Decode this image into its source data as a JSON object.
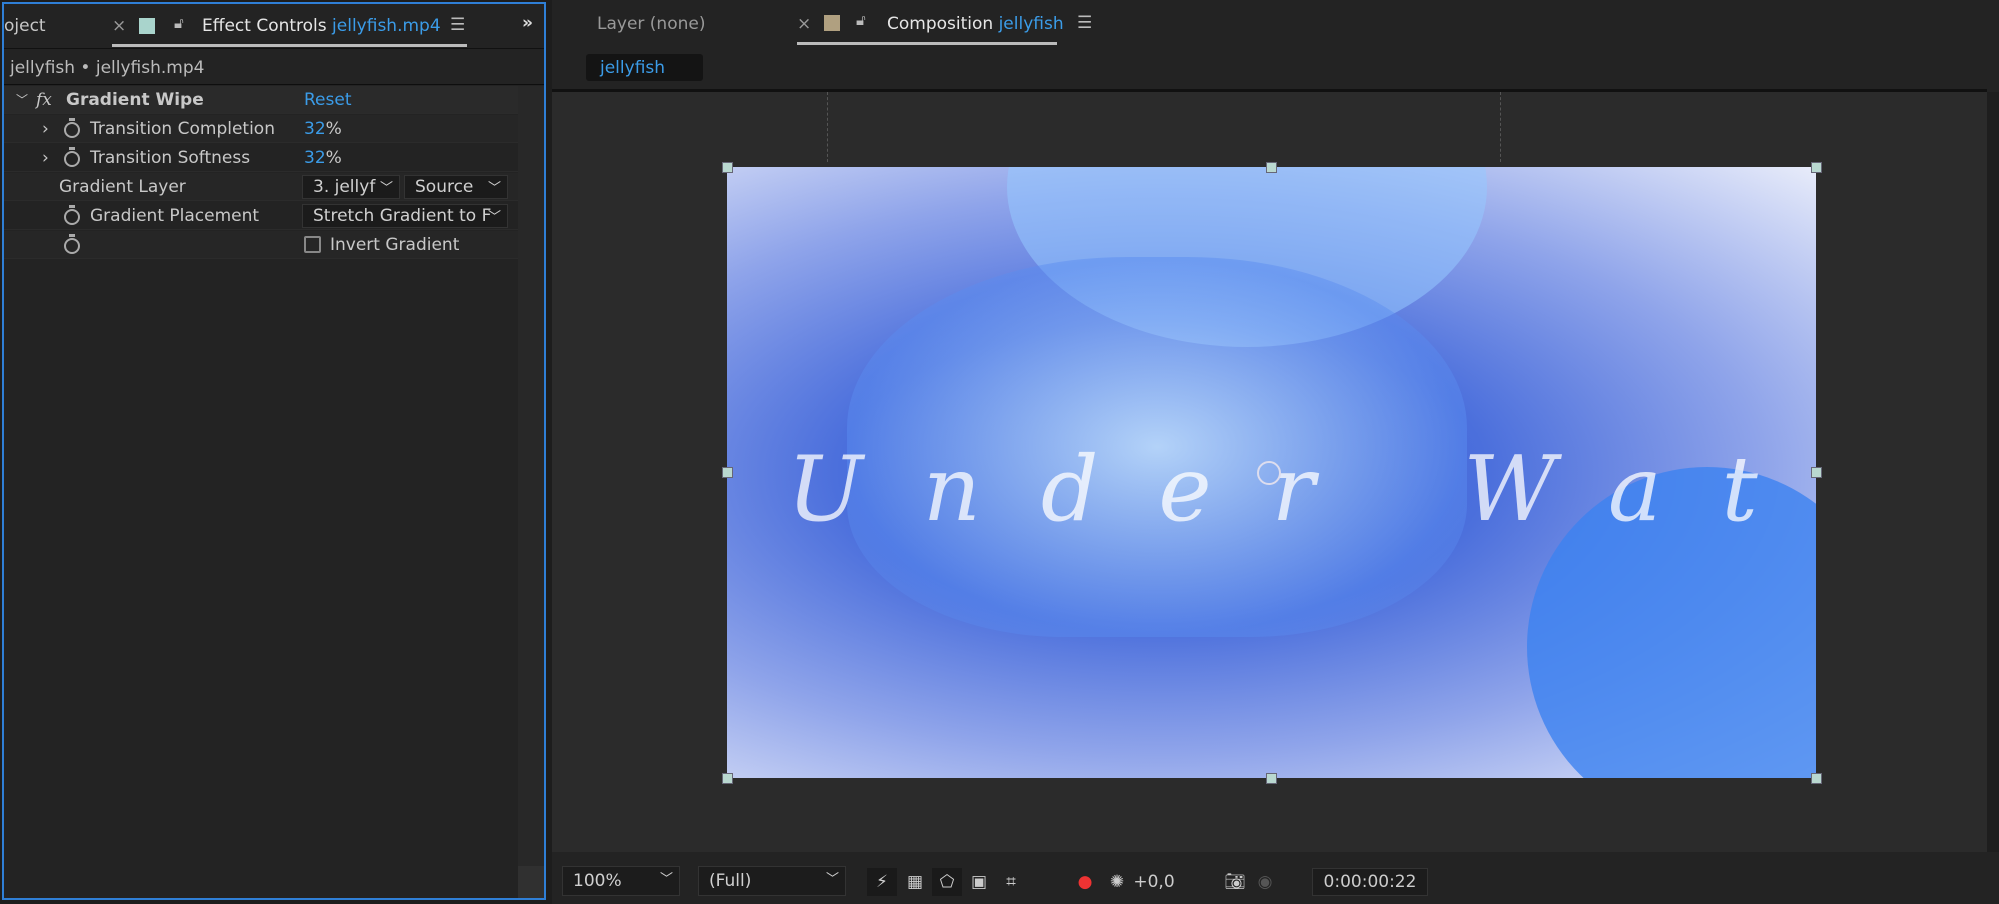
{
  "effect_panel": {
    "tabs": {
      "project_partial": "oject",
      "effect_controls_label": "Effect Controls",
      "effect_controls_file": "jellyfish.mp4",
      "label_color": "#a9d4cc"
    },
    "subtitle": "jellyfish • jellyfish.mp4",
    "effect": {
      "name": "Gradient Wipe",
      "reset": "Reset"
    },
    "properties": [
      {
        "label": "Transition Completion",
        "value": "32",
        "unit": "%"
      },
      {
        "label": "Transition Softness",
        "value": "32",
        "unit": "%"
      },
      {
        "label": "Gradient Layer",
        "layer_value": "3. jellyf",
        "source_value": "Source"
      },
      {
        "label": "Gradient Placement",
        "value": "Stretch Gradient to F"
      },
      {
        "label": "Invert Gradient",
        "checked": false
      }
    ]
  },
  "composition_panel": {
    "layer_tab": "Layer (none)",
    "comp_tab_label": "Composition",
    "comp_tab_name": "jellyfish",
    "label_color": "#b0a080",
    "breadcrumb": "jellyfish",
    "viewer_overlay_text": "Under Water",
    "toolbar": {
      "zoom": "100%",
      "resolution": "(Full)",
      "exposure": "+0,0",
      "timecode": "0:00:00:22"
    }
  },
  "colors": {
    "accent": "#3b9ce8",
    "panel_focus": "#2f7fd6"
  }
}
